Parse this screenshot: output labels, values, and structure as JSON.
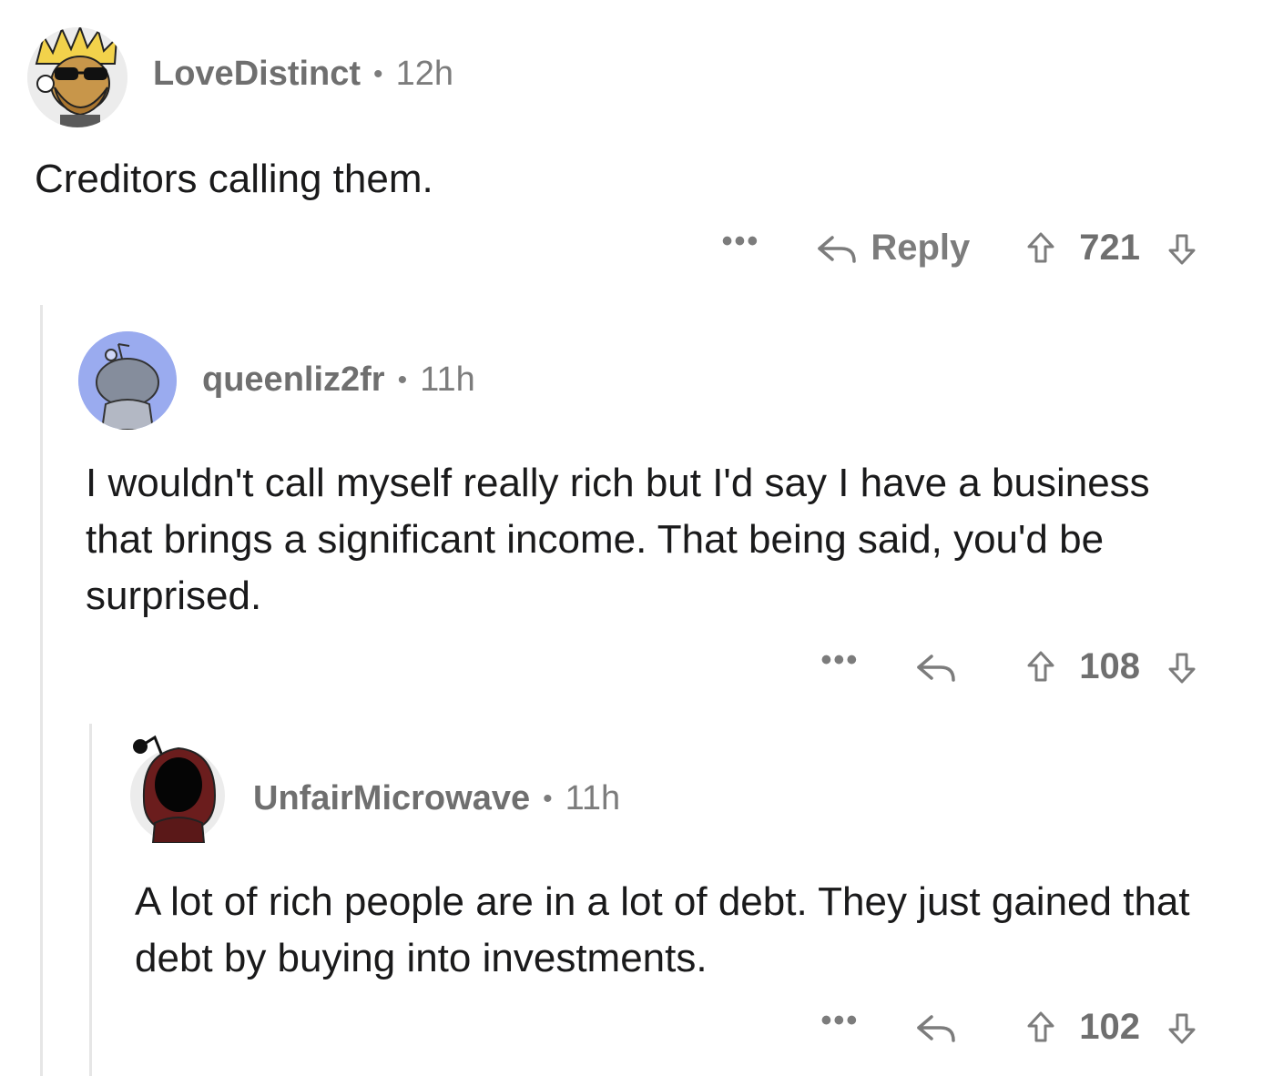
{
  "comments": [
    {
      "username": "LoveDistinct",
      "time": "12h",
      "body": "Creditors calling them.",
      "reply_label": "Reply",
      "score": "721",
      "avatar_icon": "snoo-avatar-blonde-sunglasses-beard",
      "more_icon": "more-options-icon"
    },
    {
      "username": "queenliz2fr",
      "time": "11h",
      "body": "I wouldn't call myself really rich but I'd say I have a business that brings a significant income. That being said, you'd be surprised.",
      "score": "108",
      "avatar_icon": "snoo-avatar-default-blue"
    },
    {
      "username": "UnfairMicrowave",
      "time": "11h",
      "body": "A lot of rich people are in a lot of debt. They just gained that debt by buying into investments.",
      "score": "102",
      "avatar_icon": "snoo-avatar-dark-hood"
    }
  ],
  "separator": "•",
  "more_label": "•••",
  "colors": {
    "meta": "#7c7c7c",
    "text": "#1a1a1b",
    "thread_line": "#e6e6e6",
    "avatar_blue": "#9aabef"
  }
}
